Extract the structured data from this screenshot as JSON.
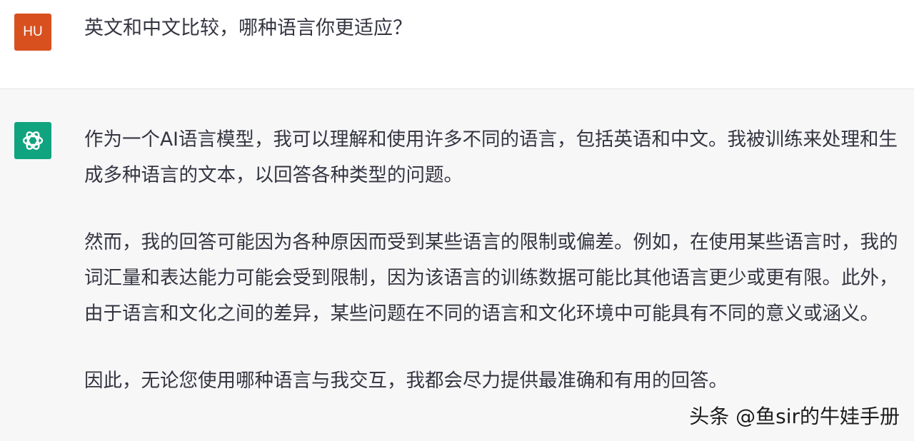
{
  "user": {
    "avatar_initials": "HU",
    "avatar_color": "#d9501f",
    "message": "英文和中文比较，哪种语言你更适应？"
  },
  "assistant": {
    "avatar_icon": "openai-logo-icon",
    "avatar_color": "#10a37f",
    "paragraphs": [
      "作为一个AI语言模型，我可以理解和使用许多不同的语言，包括英语和中文。我被训练来处理和生成多种语言的文本，以回答各种类型的问题。",
      "然而，我的回答可能因为各种原因而受到某些语言的限制或偏差。例如，在使用某些语言时，我的词汇量和表达能力可能会受到限制，因为该语言的训练数据可能比其他语言更少或更有限。此外，由于语言和文化之间的差异，某些问题在不同的语言和文化环境中可能具有不同的意义或涵义。",
      "因此，无论您使用哪种语言与我交互，我都会尽力提供最准确和有用的回答。"
    ]
  },
  "watermark": "头条 @鱼sir的牛娃手册"
}
